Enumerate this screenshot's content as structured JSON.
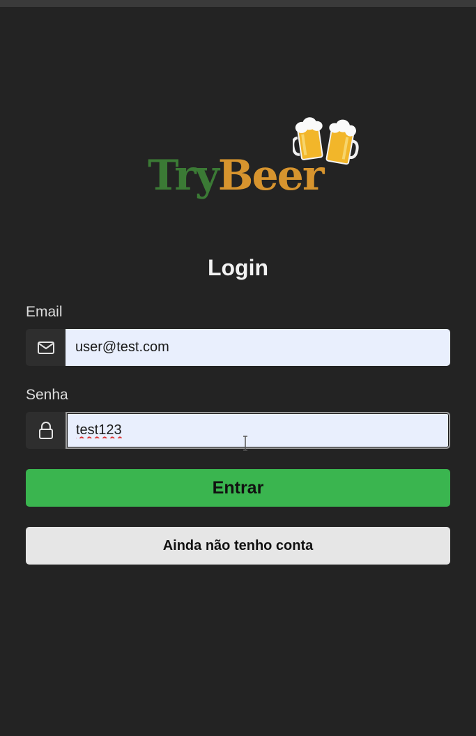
{
  "app": {
    "logo_text_try": "Try",
    "logo_text_beer": "Beer",
    "brand_colors": {
      "try": "#3b7a35",
      "beer": "#d7942e",
      "primary_button": "#3ab54f",
      "secondary_button": "#e6e6e6",
      "background": "#232323"
    }
  },
  "login": {
    "title": "Login",
    "email": {
      "label": "Email",
      "value": "user@test.com",
      "icon": "envelope-icon"
    },
    "password": {
      "label": "Senha",
      "value": "test123",
      "icon": "lock-icon"
    },
    "submit_label": "Entrar",
    "register_label": "Ainda não tenho conta"
  }
}
